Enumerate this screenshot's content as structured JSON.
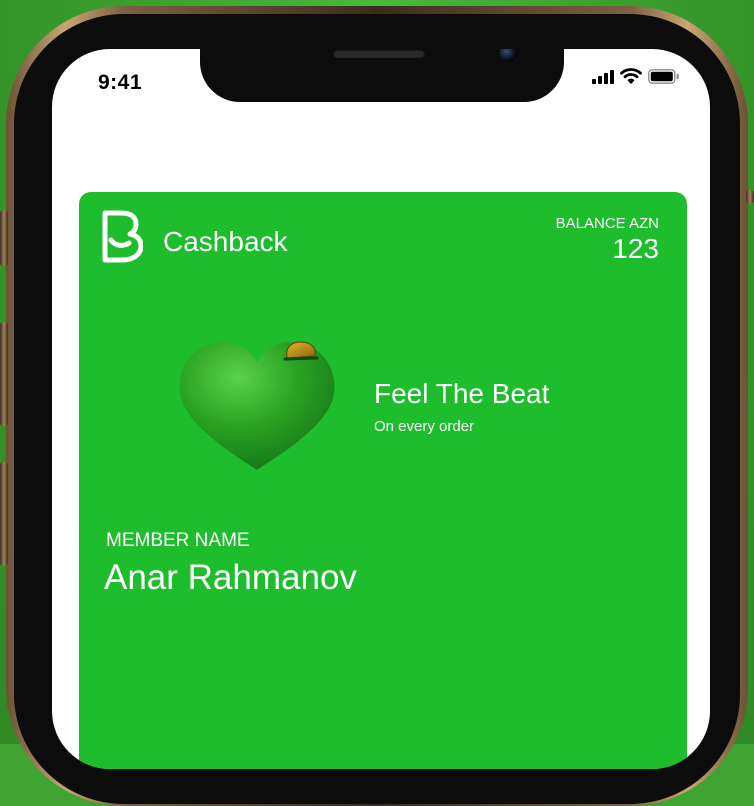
{
  "status_bar": {
    "time": "9:41",
    "icons": [
      "cellular-signal-icon",
      "wifi-icon",
      "battery-icon"
    ]
  },
  "card": {
    "brand_logo": "b-logo-icon",
    "brand_name": "Cashback",
    "balance_label": "BALANCE AZN",
    "balance_value": "123",
    "illustration": "heart-with-coin",
    "promo_title": "Feel The Beat",
    "promo_subtitle": "On every order",
    "member_label": "MEMBER NAME",
    "member_name": "Anar Rahmanov"
  },
  "colors": {
    "card_green": "#1ebd2d",
    "background_green": "#3fa431",
    "text_white": "#ffffff",
    "phone_frame_gold": "#c9a773"
  }
}
